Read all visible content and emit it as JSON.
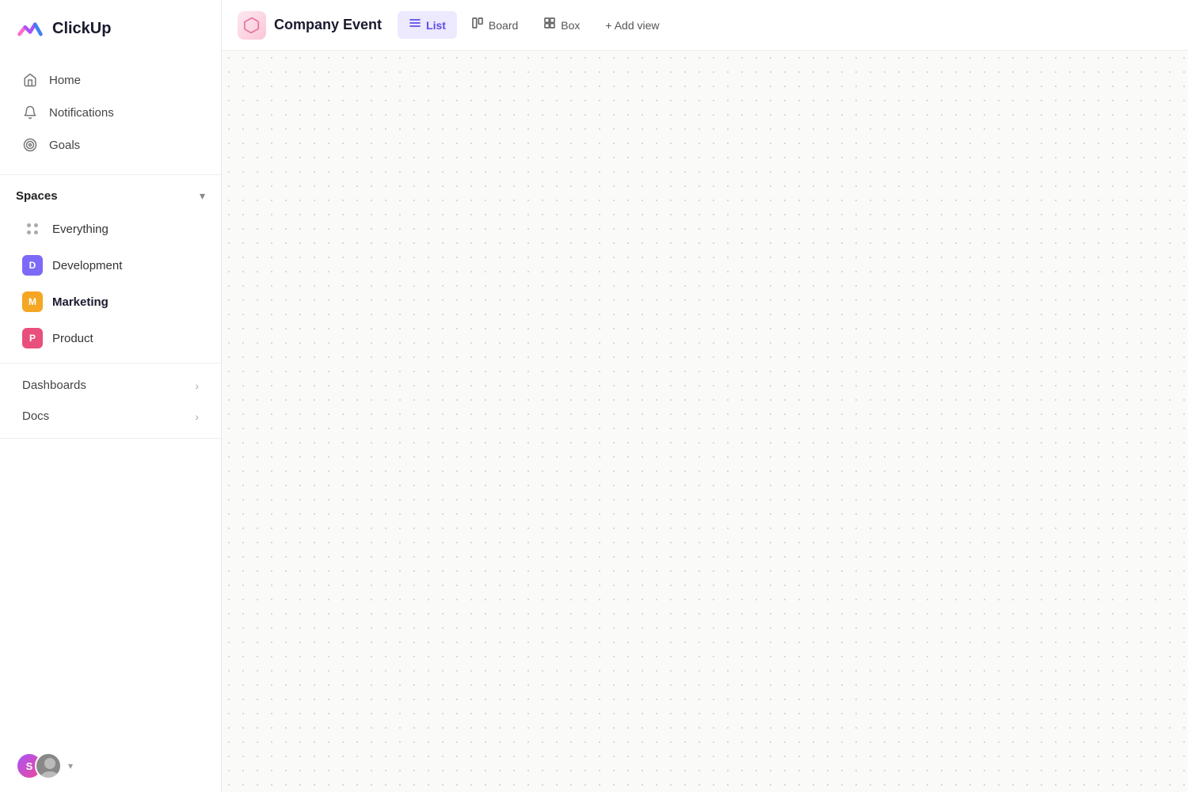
{
  "sidebar": {
    "logo_text": "ClickUp",
    "nav": {
      "home_label": "Home",
      "notifications_label": "Notifications",
      "goals_label": "Goals"
    },
    "spaces_label": "Spaces",
    "spaces_items": [
      {
        "id": "everything",
        "label": "Everything",
        "type": "dots"
      },
      {
        "id": "development",
        "label": "Development",
        "type": "avatar",
        "color": "dev",
        "initial": "D"
      },
      {
        "id": "marketing",
        "label": "Marketing",
        "type": "avatar",
        "color": "mkt",
        "initial": "M",
        "bold": true
      },
      {
        "id": "product",
        "label": "Product",
        "type": "avatar",
        "color": "prd",
        "initial": "P"
      }
    ],
    "sections": [
      {
        "id": "dashboards",
        "label": "Dashboards"
      },
      {
        "id": "docs",
        "label": "Docs"
      }
    ]
  },
  "topbar": {
    "project_title": "Company Event",
    "tabs": [
      {
        "id": "list",
        "label": "List",
        "icon": "≡",
        "active": true
      },
      {
        "id": "board",
        "label": "Board",
        "icon": "⊞",
        "active": false
      },
      {
        "id": "box",
        "label": "Box",
        "icon": "⊟",
        "active": false
      }
    ],
    "add_view_label": "+ Add view"
  }
}
